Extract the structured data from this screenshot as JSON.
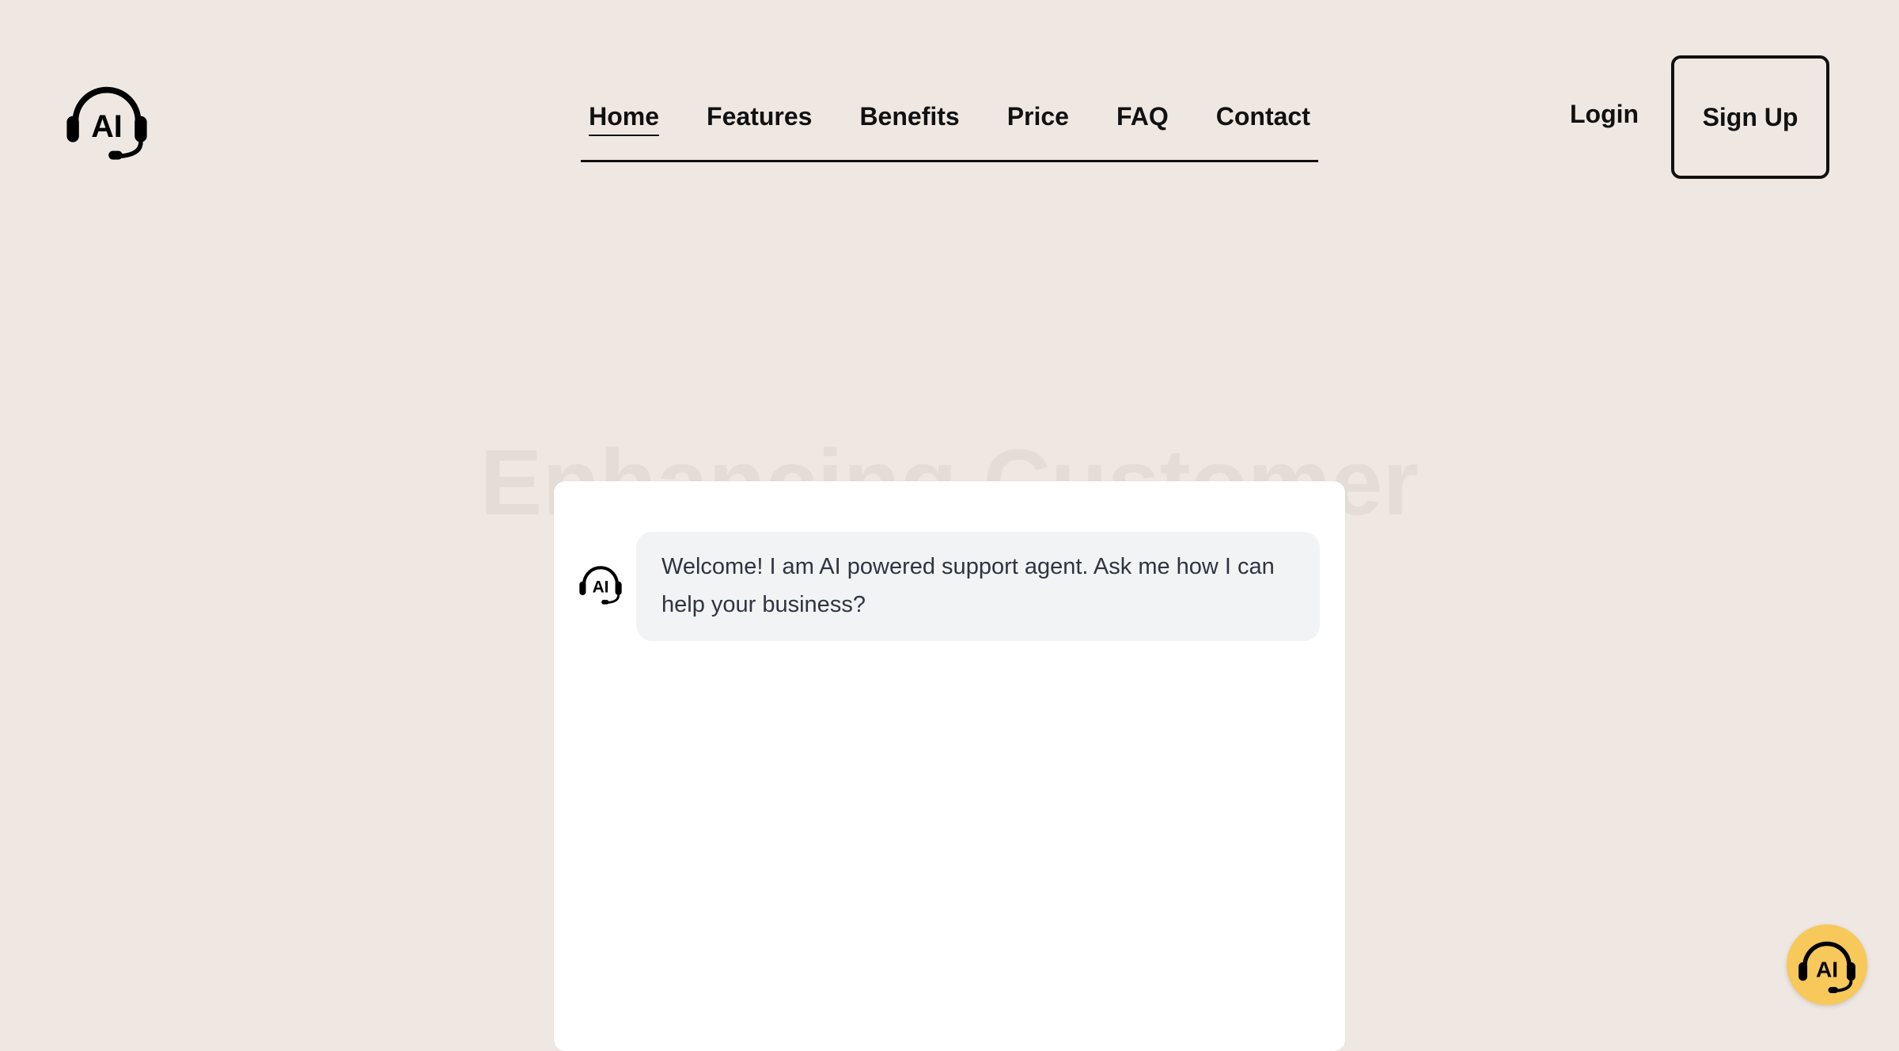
{
  "header": {
    "logo_icon": "headset-ai-icon",
    "logo_text": "AI",
    "nav": {
      "items": [
        {
          "label": "Home",
          "active": true
        },
        {
          "label": "Features"
        },
        {
          "label": "Benefits"
        },
        {
          "label": "Price"
        },
        {
          "label": "FAQ"
        },
        {
          "label": "Contact"
        }
      ]
    },
    "login_label": "Login",
    "signup_label": "Sign Up"
  },
  "hero": {
    "title": "Enhancing Customer Support with AI"
  },
  "chat": {
    "avatar_icon": "headset-ai-icon",
    "avatar_text": "AI",
    "welcome_message": "Welcome! I am AI powered support agent. Ask me how I can help your business?"
  },
  "fab": {
    "icon": "headset-ai-icon",
    "text": "AI"
  },
  "colors": {
    "background": "#efe8e2",
    "chat_bubble": "#f2f3f5",
    "fab": "#f7c85a",
    "text": "#111111"
  }
}
